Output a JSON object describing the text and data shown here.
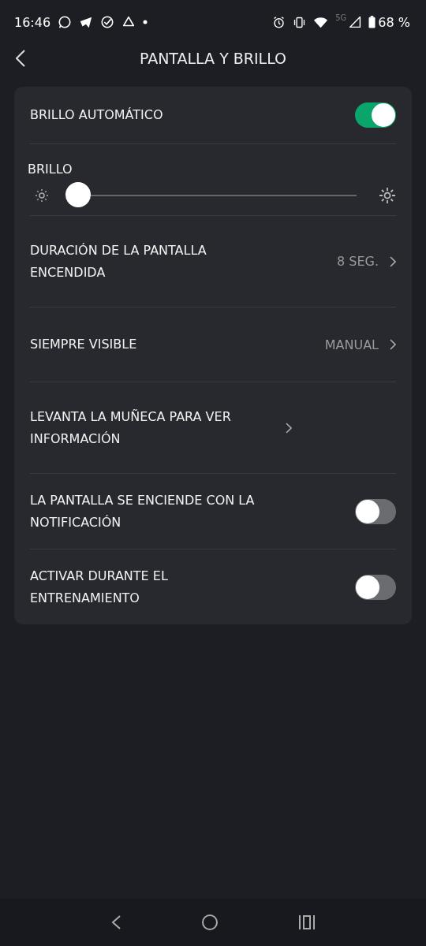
{
  "status_bar": {
    "time": "16:46",
    "network": "5G",
    "battery": "68 %"
  },
  "header": {
    "title": "PANTALLA Y BRILLO"
  },
  "settings": [
    {
      "kind": "toggle",
      "label": "BRILLO AUTOMÁTICO",
      "on": true
    },
    {
      "kind": "slider",
      "label": "BRILLO",
      "level": 0.0
    },
    {
      "kind": "link",
      "label": "DURACIÓN DE LA PANTALLA ENCENDIDA",
      "value": "8 SEG."
    },
    {
      "kind": "link",
      "label": "SIEMPRE VISIBLE",
      "value": "MANUAL"
    },
    {
      "kind": "link",
      "label": "LEVANTA LA MUÑECA PARA VER INFORMACIÓN"
    },
    {
      "kind": "toggle",
      "label": "LA PANTALLA SE ENCIENDE CON LA NOTIFICACIÓN",
      "on": false
    },
    {
      "kind": "toggle",
      "label": "ACTIVAR DURANTE EL ENTRENAMIENTO",
      "on": false
    }
  ]
}
